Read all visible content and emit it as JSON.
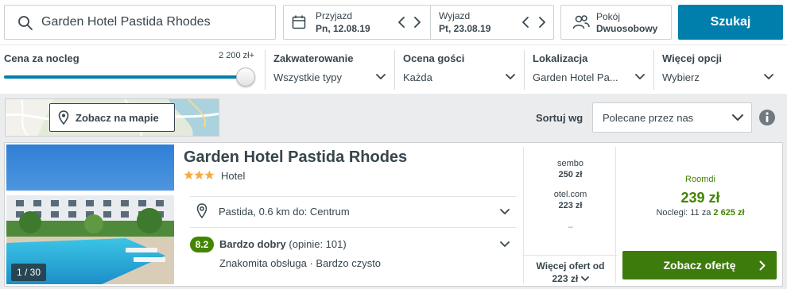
{
  "search": {
    "destination_value": "Garden Hotel Pastida Rhodes",
    "checkin_label": "Przyjazd",
    "checkin_value": "Pn, 12.08.19",
    "checkout_label": "Wyjazd",
    "checkout_value": "Pt, 23.08.19",
    "room_label": "Pokój",
    "room_value": "Dwuosobowy",
    "search_button": "Szukaj"
  },
  "filters": {
    "price_title": "Cena za nocleg",
    "price_max": "2 200 zł+",
    "price_slider_fraction": 1.0,
    "accommodation_title": "Zakwaterowanie",
    "accommodation_value": "Wszystkie typy",
    "guest_rating_title": "Ocena gości",
    "guest_rating_value": "Każda",
    "location_title": "Lokalizacja",
    "location_value": "Garden Hotel Pa...",
    "more_title": "Więcej opcji",
    "more_value": "Wybierz"
  },
  "map": {
    "button_label": "Zobacz na mapie"
  },
  "sort": {
    "label": "Sortuj wg",
    "value": "Polecane przez nas"
  },
  "result": {
    "image_counter": "1 / 30",
    "hotel_name": "Garden Hotel Pastida Rhodes",
    "stars": 3,
    "type": "Hotel",
    "location": "Pastida, 0.6 km do: Centrum",
    "rating_score": "8.2",
    "rating_label": "Bardzo dobry",
    "rating_count": "(opinie: 101)",
    "rating_highlights": "Znakomita obsługa · Bardzo czysto",
    "other_offers": [
      {
        "partner": "sembo",
        "price": "250 zł"
      },
      {
        "partner": "otel.com",
        "price": "223 zł"
      }
    ],
    "other_offers_dash": "–",
    "more_offers_label": "Więcej ofert od",
    "more_offers_price": "223 zł",
    "deal_partner": "Roomdi",
    "deal_price": "239 zł",
    "deal_nights_prefix": "Noclegi: 11 za",
    "deal_nights_total": "2 625 zł",
    "deal_button": "Zobacz ofertę"
  },
  "colors": {
    "primary_blue": "#007fad",
    "deal_green": "#428500",
    "deal_button_green": "#3d7b0c",
    "text": "#37454d",
    "star": "#f6ab3f"
  }
}
